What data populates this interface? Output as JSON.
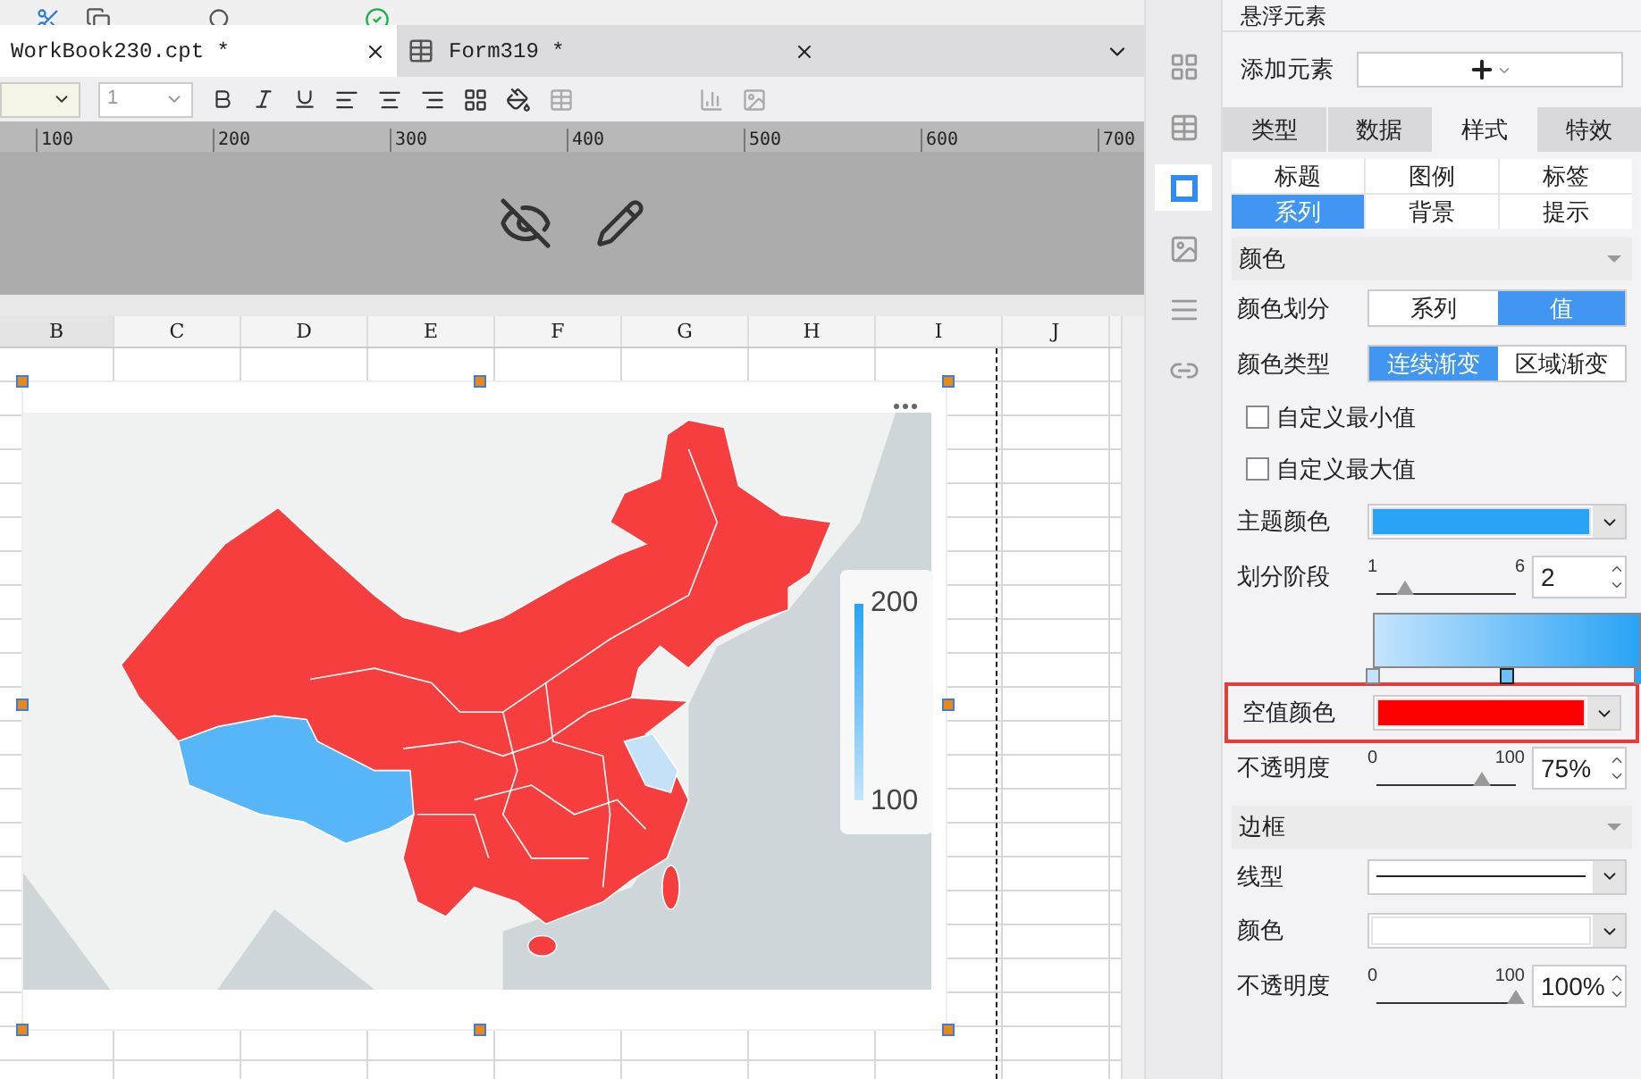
{
  "tabs": [
    {
      "label": "WorkBook230.cpt *",
      "selected": true
    },
    {
      "label": "Form319 *",
      "selected": false
    }
  ],
  "toolbar": {
    "font_size": "1"
  },
  "ruler": [
    "100",
    "200",
    "300",
    "400",
    "500",
    "600",
    "700"
  ],
  "columns": [
    "B",
    "C",
    "D",
    "E",
    "F",
    "G",
    "H",
    "I",
    "J"
  ],
  "legend": {
    "max": "200",
    "min": "100"
  },
  "side_tools": [
    {
      "selected": false
    },
    {
      "selected": false
    },
    {
      "selected": true
    },
    {
      "selected": false
    },
    {
      "selected": false
    },
    {
      "selected": false
    }
  ],
  "panel": {
    "title": "悬浮元素",
    "add_label": "添加元素",
    "tabs": [
      {
        "label": "类型",
        "selected": false
      },
      {
        "label": "数据",
        "selected": false
      },
      {
        "label": "样式",
        "selected": true
      },
      {
        "label": "特效",
        "selected": false
      }
    ],
    "subtabs": [
      {
        "label": "标题",
        "selected": false
      },
      {
        "label": "图例",
        "selected": false
      },
      {
        "label": "标签",
        "selected": false
      },
      {
        "label": "系列",
        "selected": true
      },
      {
        "label": "背景",
        "selected": false
      },
      {
        "label": "提示",
        "selected": false
      }
    ],
    "sections": [
      {
        "title": "颜色",
        "rows": [
          {
            "kind": "segmented",
            "label": "颜色划分",
            "options": [
              {
                "label": "系列",
                "selected": false
              },
              {
                "label": "值",
                "selected": true
              }
            ]
          },
          {
            "kind": "segmented",
            "label": "颜色类型",
            "options": [
              {
                "label": "连续渐变",
                "selected": true
              },
              {
                "label": "区域渐变",
                "selected": false
              }
            ]
          },
          {
            "kind": "checkbox",
            "label": "自定义最小值",
            "checked": false
          },
          {
            "kind": "checkbox",
            "label": "自定义最大值",
            "checked": false
          },
          {
            "kind": "color",
            "label": "主题颜色",
            "color": "#29a3f5",
            "highlighted": false
          },
          {
            "kind": "slider",
            "label": "划分阶段",
            "min": "1",
            "max": "6",
            "level": 0.2,
            "value": "2"
          },
          {
            "kind": "gradient"
          },
          {
            "kind": "color",
            "label": "空值颜色",
            "color": "#ff0000",
            "highlighted": true
          },
          {
            "kind": "slider",
            "label": "不透明度",
            "min": "0",
            "max": "100",
            "level": 0.75,
            "value": "75%"
          }
        ]
      },
      {
        "title": "边框",
        "rows": [
          {
            "kind": "line",
            "label": "线型"
          },
          {
            "kind": "color",
            "label": "颜色",
            "color": "#ffffff",
            "highlighted": false
          },
          {
            "kind": "slider",
            "label": "不透明度",
            "min": "0",
            "max": "100",
            "level": 1,
            "value": "100%"
          }
        ]
      }
    ]
  }
}
